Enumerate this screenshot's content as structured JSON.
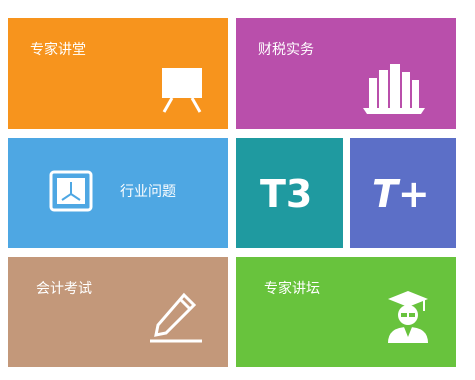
{
  "tiles": {
    "expert_lecture": {
      "label": "专家讲堂",
      "color": "#f7941d",
      "icon": "easel-icon"
    },
    "tax_practice": {
      "label": "财税实务",
      "color": "#b94fab",
      "icon": "books-icon"
    },
    "industry_issues": {
      "label": "行业问题",
      "color": "#4ea7e3",
      "icon": "image-frame-icon"
    },
    "t3": {
      "label": "T3",
      "color": "#1f9aa0"
    },
    "t_plus": {
      "label": "T+",
      "color": "#5c6fc7"
    },
    "accounting_exam": {
      "label": "会计考试",
      "color": "#c3987a",
      "icon": "pen-icon"
    },
    "expert_forum": {
      "label": "专家讲坛",
      "color": "#68c33d",
      "icon": "graduate-icon"
    }
  }
}
